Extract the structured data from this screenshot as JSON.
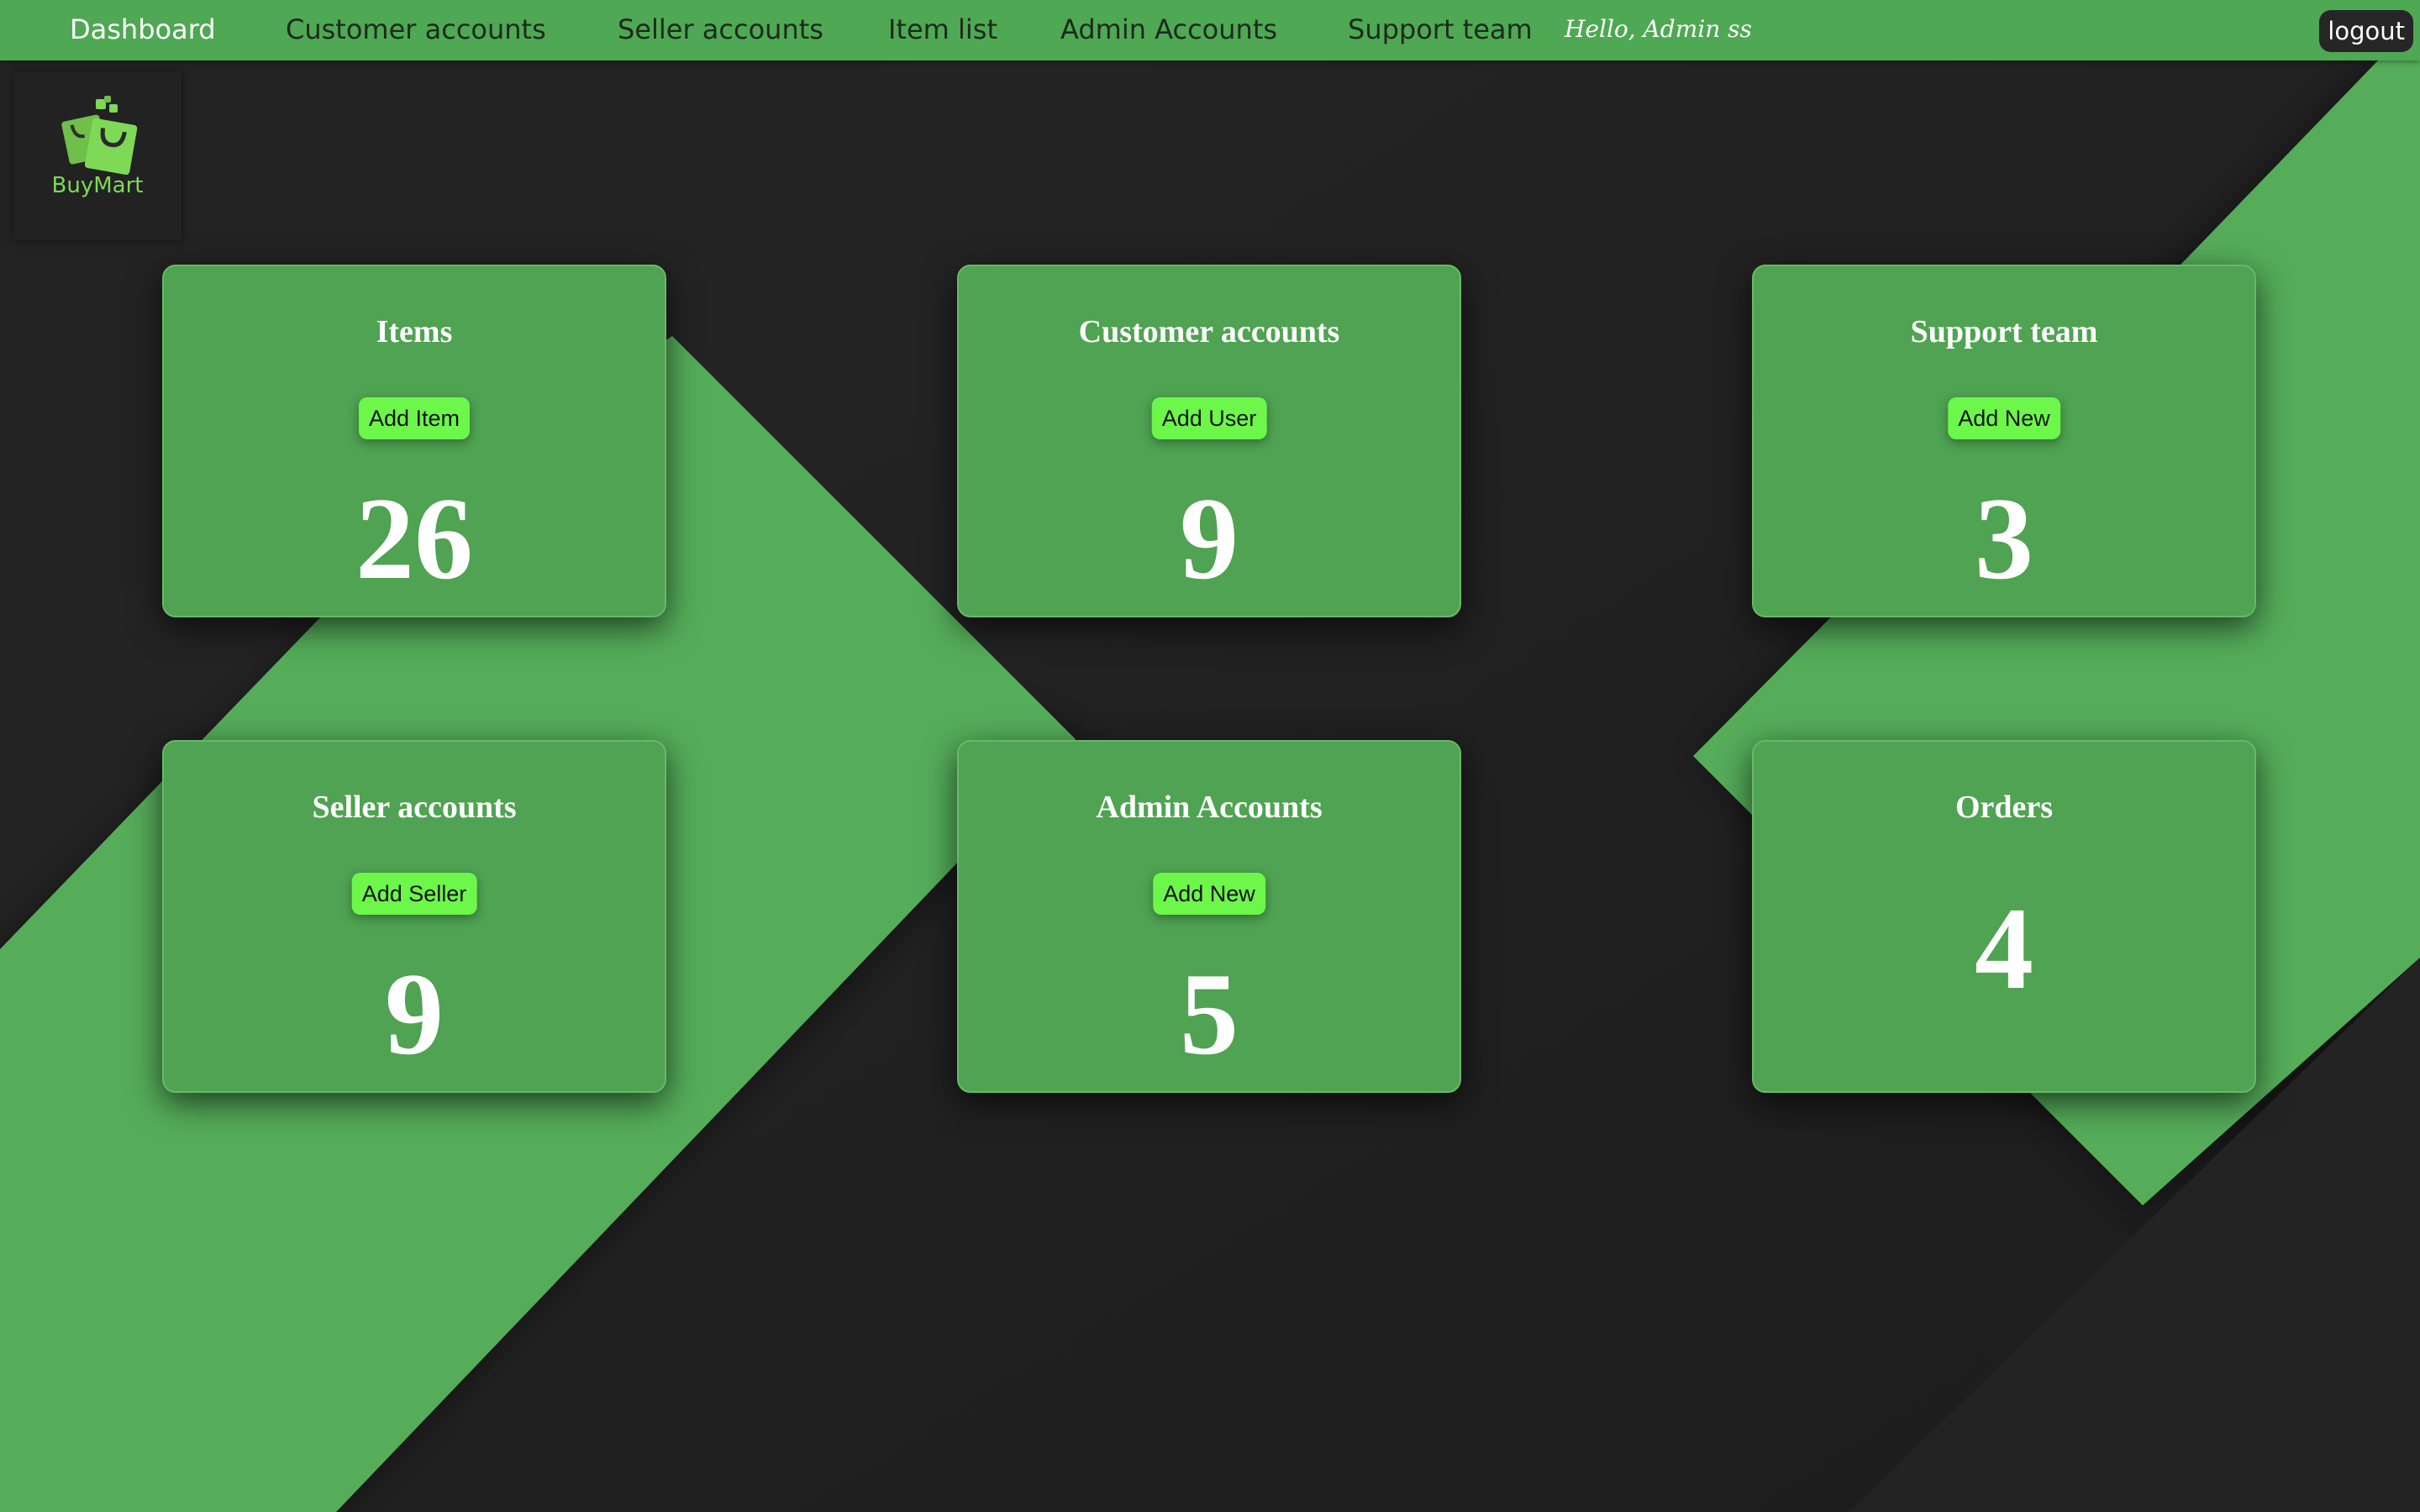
{
  "nav": {
    "items": [
      {
        "label": "Dashboard",
        "active": true
      },
      {
        "label": "Customer accounts",
        "active": false
      },
      {
        "label": "Seller accounts",
        "active": false
      },
      {
        "label": "Item list",
        "active": false
      },
      {
        "label": "Admin Accounts",
        "active": false
      },
      {
        "label": "Support team",
        "active": false
      }
    ],
    "greeting": "Hello, Admin ss",
    "logout_label": "logout"
  },
  "logo": {
    "brand": "BuyMart"
  },
  "cards": [
    {
      "title": "Items",
      "button": "Add Item",
      "count": "26"
    },
    {
      "title": "Customer accounts",
      "button": "Add User",
      "count": "9"
    },
    {
      "title": "Support team",
      "button": "Add New",
      "count": "3"
    },
    {
      "title": "Seller accounts",
      "button": "Add Seller",
      "count": "9"
    },
    {
      "title": "Admin Accounts",
      "button": "Add New",
      "count": "5"
    },
    {
      "title": "Orders",
      "count": "4"
    }
  ],
  "colors": {
    "nav_bg": "#4fa853",
    "card_bg": "#4fa352",
    "button_bg": "#6cf74a",
    "page_dark": "#1e1e1e",
    "accent_green": "#55ad5a"
  }
}
